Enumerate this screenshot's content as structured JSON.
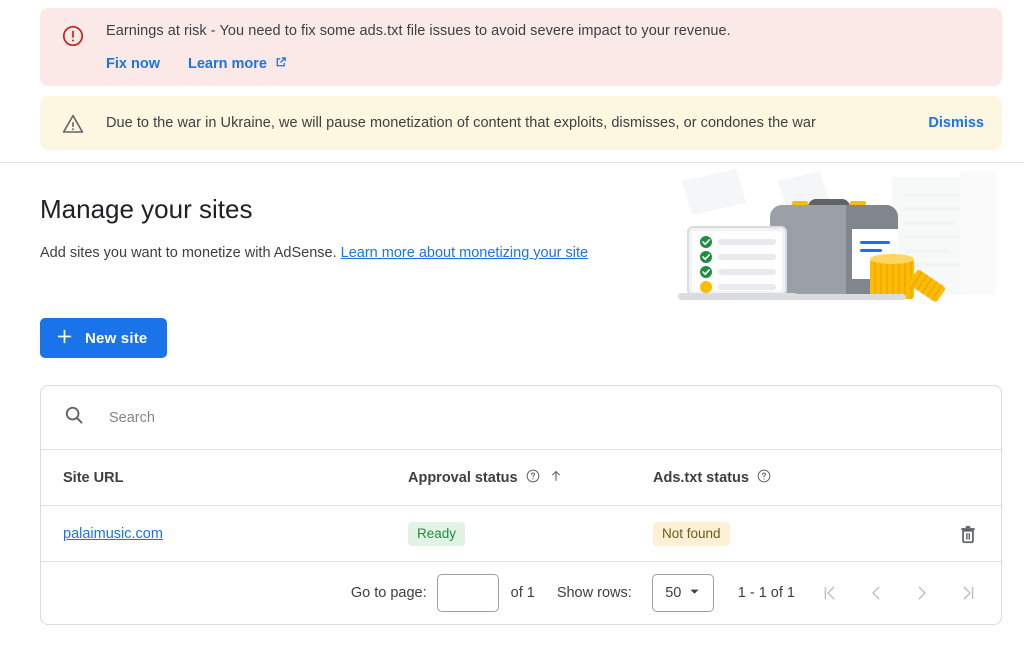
{
  "banners": {
    "error": {
      "icon": "error-circle-icon",
      "message": "Earnings at risk - You need to fix some ads.txt file issues to avoid severe impact to your revenue.",
      "primary_action": "Fix now",
      "secondary_action": "Learn more",
      "secondary_action_icon": "external-link-icon",
      "bg_color": "#fbe9e7",
      "icon_color": "#c5221f",
      "link_color": "#1a73e8"
    },
    "warning": {
      "icon": "warning-triangle-icon",
      "message": "Due to the war in Ukraine, we will pause monetization of content that exploits, dismisses, or condones the war",
      "dismiss_label": "Dismiss",
      "bg_color": "#fdf6e1",
      "icon_color": "#5f6368",
      "link_color": "#1a73e8"
    }
  },
  "hero": {
    "title": "Manage your sites",
    "subtitle_text": "Add sites you want to monetize with AdSense.",
    "subtitle_link": "Learn more about monetizing your site",
    "illustration": "briefcase-checklist-coins-illustration"
  },
  "actions": {
    "new_site_label": "New site",
    "new_site_icon": "plus-icon",
    "new_site_color": "#1a73e8"
  },
  "search": {
    "placeholder": "Search",
    "value": "",
    "icon": "search-icon"
  },
  "table": {
    "columns": [
      {
        "label": "Site URL",
        "help_icon": false,
        "sort_icon": false
      },
      {
        "label": "Approval status",
        "help_icon": true,
        "sort_icon": true
      },
      {
        "label": "Ads.txt status",
        "help_icon": true,
        "sort_icon": false
      }
    ],
    "rows": [
      {
        "site_url": "palaimusic.com",
        "approval_status": "Ready",
        "ads_txt_status": "Not found",
        "delete_icon": "trash-icon"
      }
    ],
    "badge_colors": {
      "ready_bg": "#e2f3e6",
      "ready_fg": "#1e8e3e",
      "notfound_bg": "#fdf0d5",
      "notfound_fg": "#6b5a1e"
    }
  },
  "pagination": {
    "go_to_page_label": "Go to page:",
    "page_value": "",
    "of_label": "of 1",
    "show_rows_label": "Show rows:",
    "rows_per_page": "50",
    "rows_dropdown_icon": "chevron-down-icon",
    "range_label": "1 - 1 of 1",
    "first_icon": "first-page-icon",
    "prev_icon": "previous-page-icon",
    "next_icon": "next-page-icon",
    "last_icon": "last-page-icon"
  }
}
